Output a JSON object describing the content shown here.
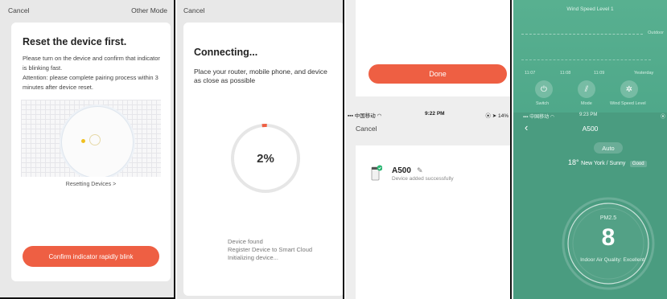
{
  "colors": {
    "accent": "#ee5f43",
    "progress_track": "#e6e6e6",
    "success": "#2bb673",
    "app_green": "#4a9c80"
  },
  "screen1": {
    "cancel": "Cancel",
    "other_mode": "Other Mode",
    "title": "Reset the device first.",
    "desc_1": "Please turn on the device and confirm that indicator is blinking fast.",
    "desc_2": "Attention: please complete pairing process within 3 minutes after device reset.",
    "resetting_link": "Resetting Devices >",
    "confirm_button": "Confirm indicator rapidly blink"
  },
  "screen2": {
    "cancel": "Cancel",
    "title": "Connecting...",
    "desc": "Place your router, mobile phone, and device as close as possible",
    "progress_percent": 2,
    "progress_label": "2%",
    "steps": [
      "Device found",
      "Register Device to Smart Cloud",
      "Initializing device..."
    ]
  },
  "screen3": {
    "done_button": "Done",
    "status_left": "中国移动",
    "status_time": "9:22 PM",
    "status_right": "14%",
    "cancel": "Cancel",
    "device_name": "A500",
    "device_status": "Device added successfully"
  },
  "screen4": {
    "wind_speed_label": "Wind Speed   Level 1",
    "outdoor": "Outdoor",
    "times": [
      "11:07",
      "11:08",
      "11:09",
      "Yesterday"
    ],
    "controls": [
      {
        "label": "Switch",
        "icon": "power-icon"
      },
      {
        "label": "Mode",
        "icon": "mode-icon"
      },
      {
        "label": "Wind Speed Level",
        "icon": "fan-icon"
      }
    ],
    "status_left": "中国移动",
    "status_time": "9:23 PM",
    "title": "A500",
    "mode": "Auto",
    "temperature": "18°",
    "location": "New York / Sunny",
    "air_quality_badge": "Good",
    "pm_label": "PM2.5",
    "pm_value": "8",
    "indoor_quality": "Indoor Air Quality: Excellent"
  }
}
